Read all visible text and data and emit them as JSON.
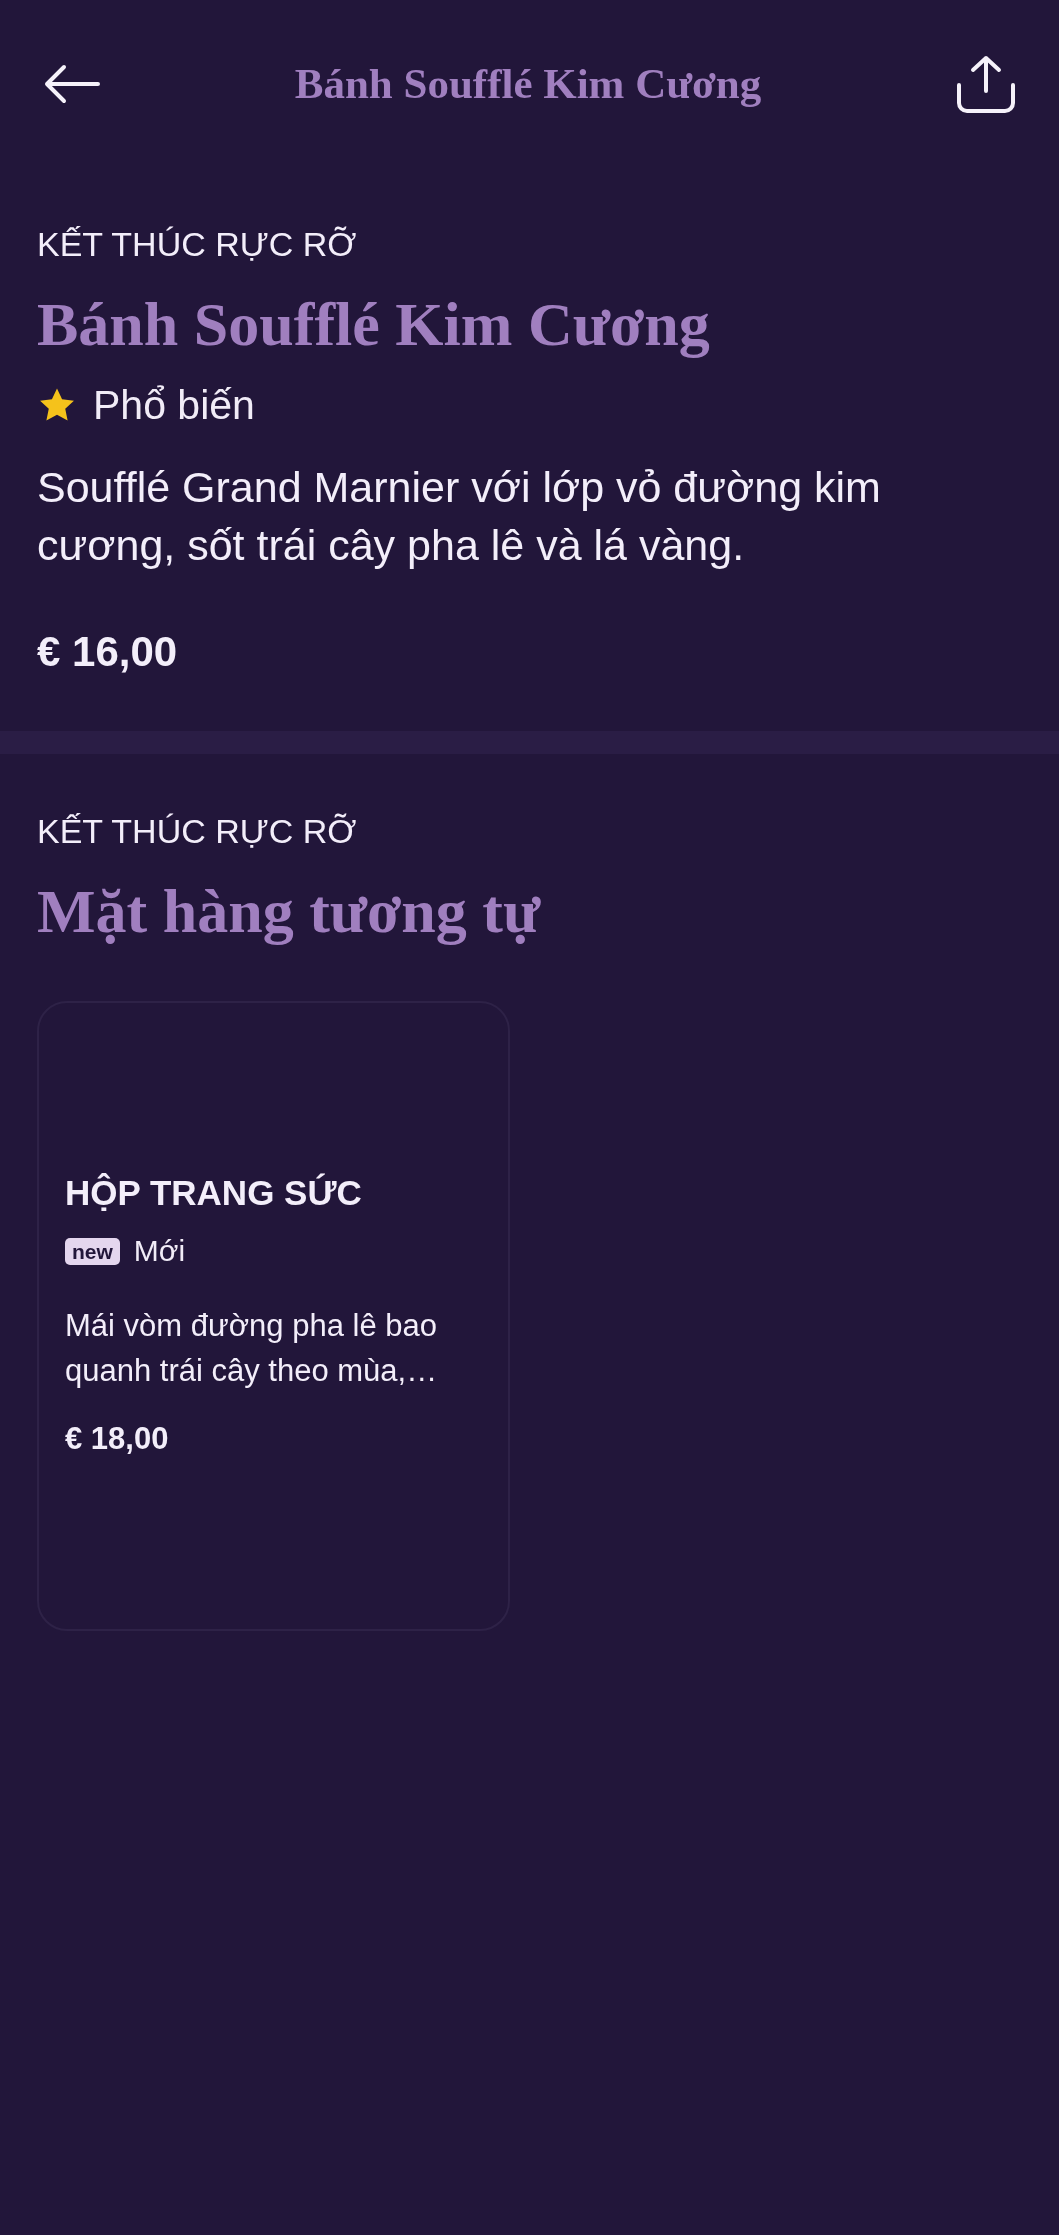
{
  "header": {
    "title": "Bánh Soufflé Kim Cương"
  },
  "product": {
    "category": "KẾT THÚC RỰC RỠ",
    "name": "Bánh Soufflé Kim Cương",
    "tag": {
      "kind": "popular",
      "label": "Phổ biến"
    },
    "description": "Soufflé Grand Marnier với lớp vỏ đường kim cương, sốt trái cây pha lê và lá vàng.",
    "price": "€ 16,00"
  },
  "similar": {
    "category": "KẾT THÚC RỰC RỠ",
    "title": "Mặt hàng tương tự",
    "items": [
      {
        "name": "HỘP TRANG SỨC",
        "tag": {
          "kind": "new",
          "badge": "new",
          "label": "Mới"
        },
        "description": "Mái vòm đường pha lê bao quanh trái cây theo mùa,…",
        "price": "€ 18,00"
      }
    ]
  }
}
